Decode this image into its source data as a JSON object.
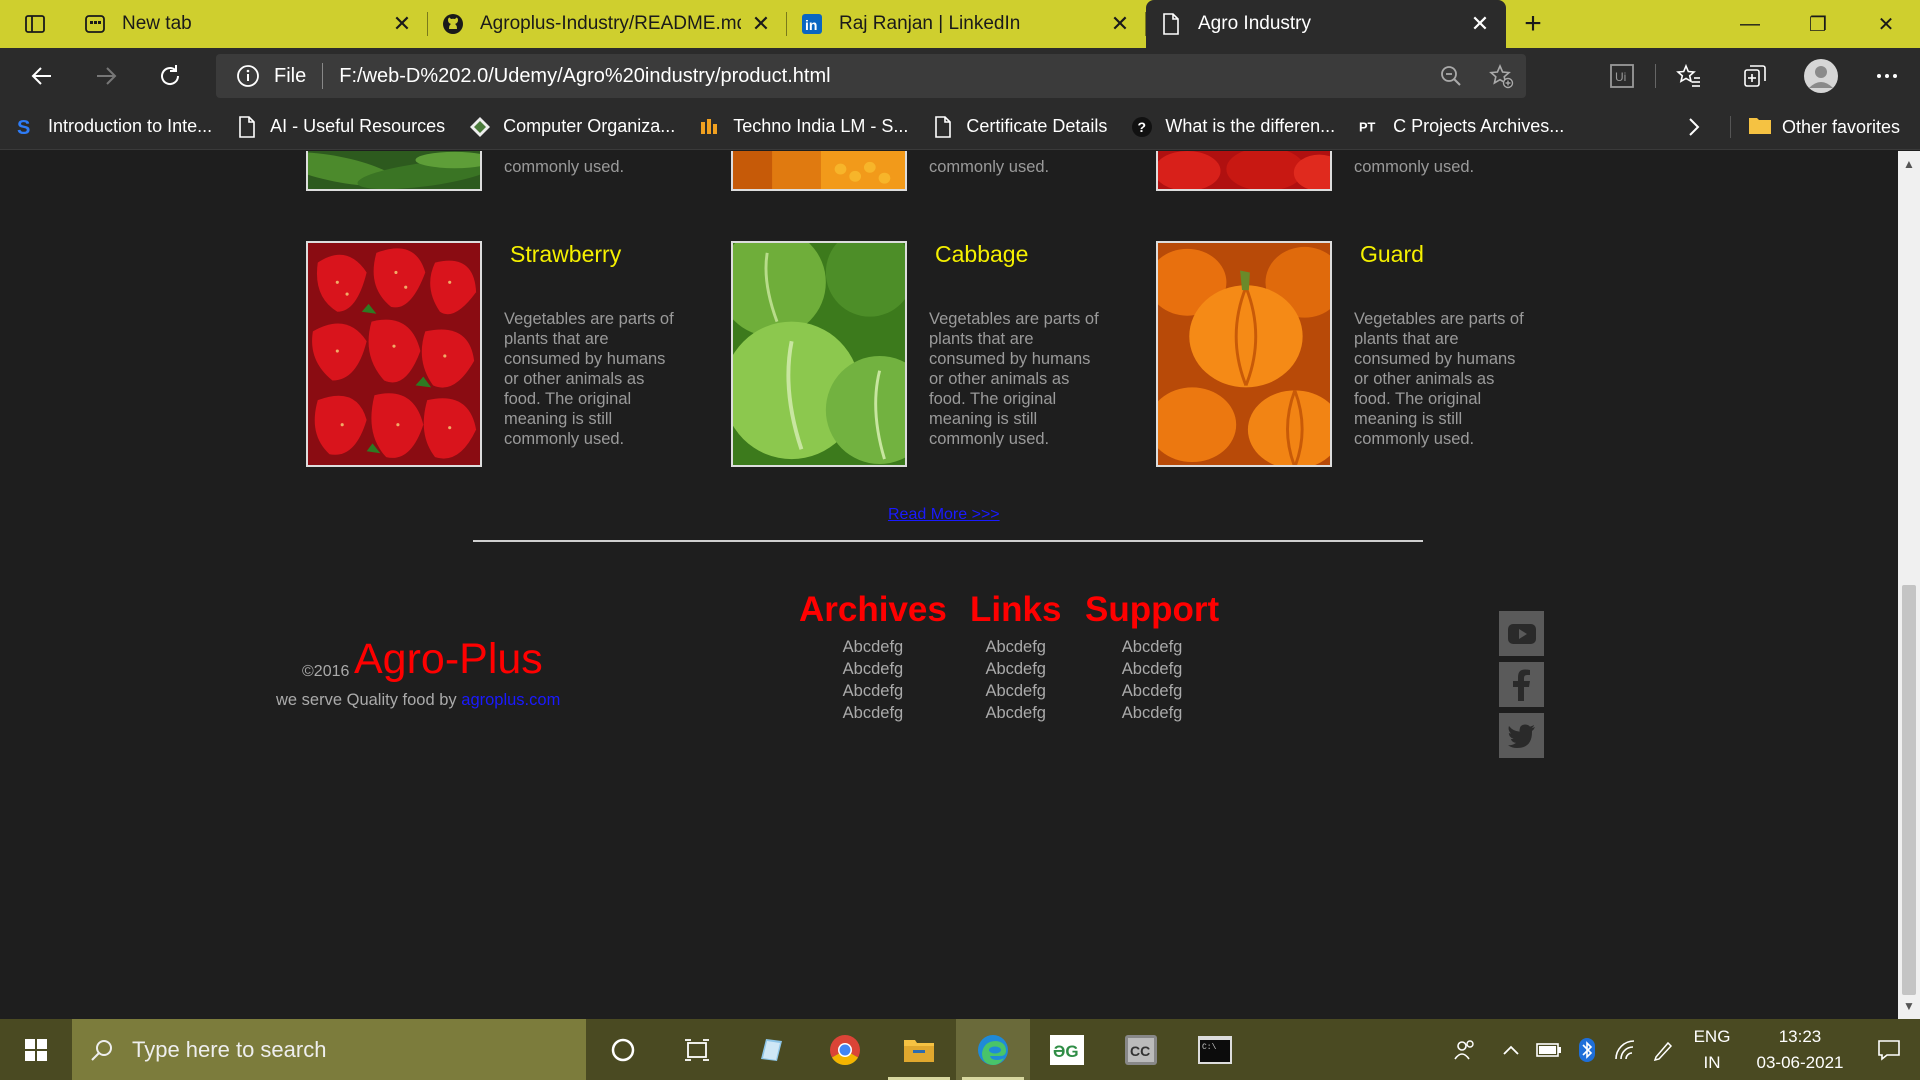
{
  "browser": {
    "tabs": [
      {
        "title": "New tab",
        "icon": "newtab-icon"
      },
      {
        "title": "Agroplus-Industry/README.md a",
        "icon": "github-icon"
      },
      {
        "title": "Raj Ranjan | LinkedIn",
        "icon": "linkedin-icon"
      },
      {
        "title": "Agro Industry",
        "icon": "page-icon"
      }
    ],
    "address": {
      "scheme_label": "File",
      "url": "F:/web-D%202.0/Udemy/Agro%20industry/product.html"
    },
    "favorites": [
      {
        "label": "Introduction to Inte...",
        "icon": "s-logo-icon"
      },
      {
        "label": "AI - Useful Resources",
        "icon": "page-icon"
      },
      {
        "label": "Computer Organiza...",
        "icon": "diamond-icon"
      },
      {
        "label": "Techno India LM - S...",
        "icon": "techno-icon"
      },
      {
        "label": "Certificate Details",
        "icon": "page-icon"
      },
      {
        "label": "What is the differen...",
        "icon": "question-icon"
      },
      {
        "label": "C Projects Archives...",
        "icon": "pt-icon"
      }
    ],
    "other_favorites": "Other favorites"
  },
  "page": {
    "top_row": [
      {
        "desc": "commonly used."
      },
      {
        "desc": "commonly used."
      },
      {
        "desc": "commonly used."
      }
    ],
    "products": [
      {
        "name": "Strawberry",
        "desc": "Vegetables are parts of plants that are consumed by humans or other animals as food. The original meaning is still commonly used."
      },
      {
        "name": "Cabbage",
        "desc": "Vegetables are parts of plants that are consumed by humans or other animals as food. The original meaning is still commonly used."
      },
      {
        "name": "Guard",
        "desc": "Vegetables are parts of plants that are consumed by humans or other animals as food. The original meaning is still commonly used."
      }
    ],
    "read_more": "Read More >>>",
    "footer": {
      "copyright": "©2016",
      "brand": "Agro-Plus",
      "tagline": "we serve Quality food by",
      "link": "agroplus.com",
      "columns": [
        {
          "title": "Archives",
          "items": [
            "Abcdefg",
            "Abcdefg",
            "Abcdefg",
            "Abcdefg"
          ]
        },
        {
          "title": "Links",
          "items": [
            "Abcdefg",
            "Abcdefg",
            "Abcdefg",
            "Abcdefg"
          ]
        },
        {
          "title": "Support",
          "items": [
            "Abcdefg",
            "Abcdefg",
            "Abcdefg",
            "Abcdefg"
          ]
        }
      ],
      "social": [
        "youtube-icon",
        "facebook-icon",
        "twitter-icon"
      ]
    }
  },
  "taskbar": {
    "search_placeholder": "Type here to search",
    "lang_line1": "ENG",
    "lang_line2": "IN",
    "time": "13:23",
    "date": "03-06-2021"
  },
  "colors": {
    "tabbar": "#cfcf2e",
    "product_title": "#f5f000",
    "footer_heading": "#ff0000",
    "page_bg": "#1e1e1e"
  }
}
